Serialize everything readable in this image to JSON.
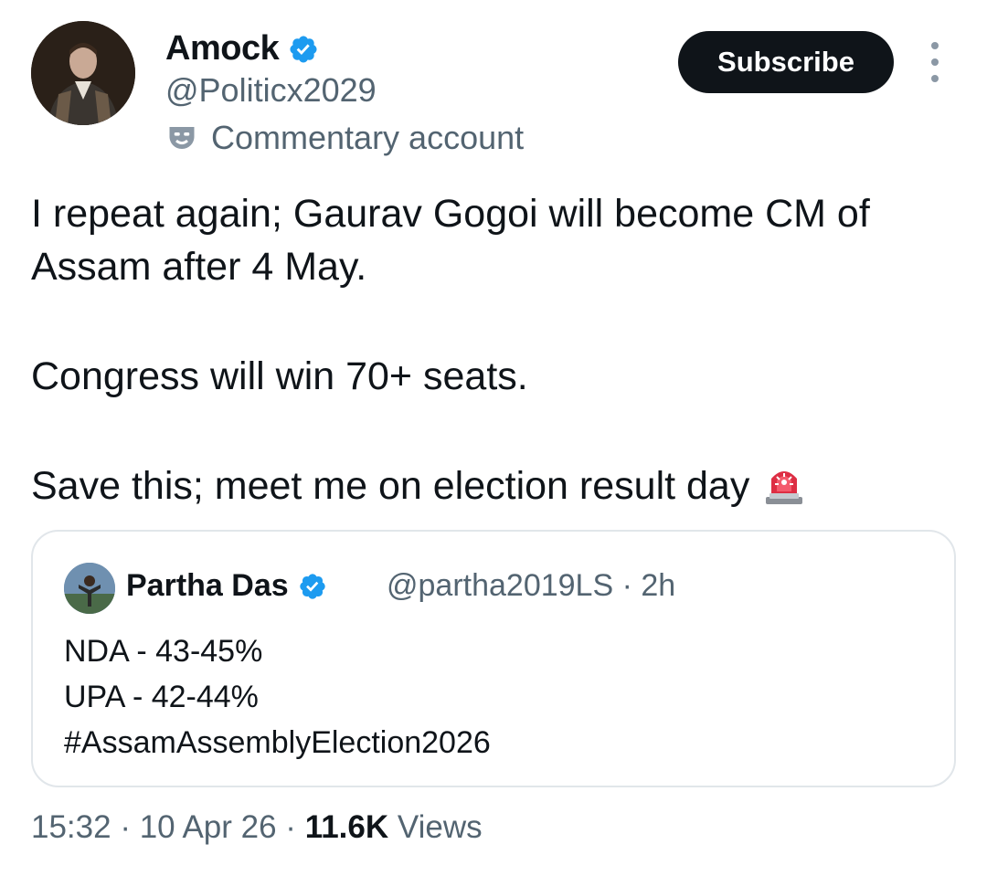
{
  "author": {
    "name": "Amock",
    "handle": "@Politicx2029",
    "label": "Commentary account"
  },
  "actions": {
    "subscribe_label": "Subscribe"
  },
  "tweet": {
    "line1": "I repeat again; Gaurav Gogoi will become CM of Assam after 4 May.",
    "line2": "Congress will win 70+ seats.",
    "line3": "Save this; meet me on election result day"
  },
  "quoted": {
    "name": "Partha Das",
    "handle": "@partha2019LS",
    "time": "2h",
    "lines": [
      "NDA - 43-45%",
      "UPA - 42-44%",
      "#AssamAssemblyElection2026"
    ]
  },
  "footer": {
    "time": "15:32",
    "date": "10 Apr 26",
    "views_count": "11.6K",
    "views_label": "Views"
  },
  "colors": {
    "verified": "#1d9bf0",
    "primary_text": "#0f1419",
    "secondary_text": "#536471",
    "border": "#e1e6ea"
  },
  "icons": {
    "verified": "verified-badge-icon",
    "label": "commentary-mask-icon",
    "more": "more-options-icon",
    "emoji": "police-siren-emoji"
  }
}
